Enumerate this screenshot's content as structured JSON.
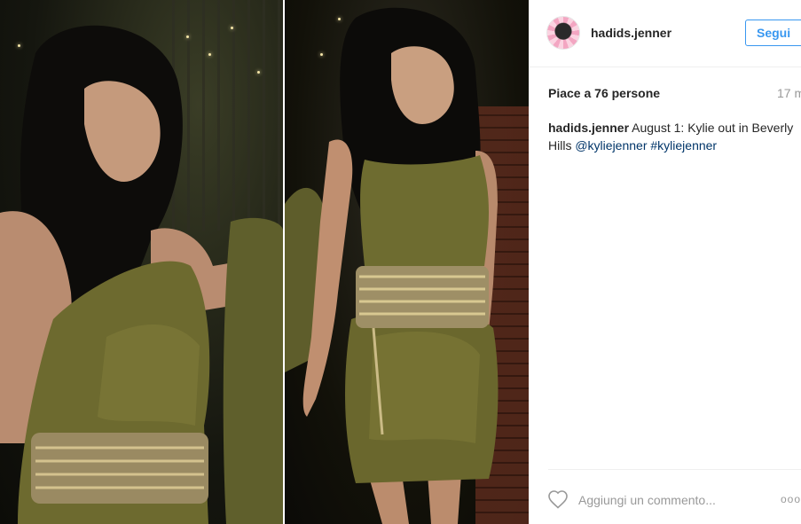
{
  "post": {
    "username": "hadids.jenner",
    "follow_label": "Segui",
    "likes_text": "Piace a 76 persone",
    "time_text": "17 m",
    "caption": {
      "user": "hadids.jenner",
      "text_line1": " August 1: Kylie out in Beverly",
      "text_line2": "Hills ",
      "mention": "@kyliejenner",
      "hashtag": "#kyliejenner"
    },
    "comment_placeholder": "Aggiungi un commento...",
    "more_label": "ooo"
  },
  "icons": {
    "like": "heart-icon",
    "more": "ellipsis-icon",
    "avatar": "profile-avatar"
  },
  "colors": {
    "accent": "#3897f0",
    "hashtag": "#003569",
    "text": "#262626",
    "muted": "#999999"
  }
}
